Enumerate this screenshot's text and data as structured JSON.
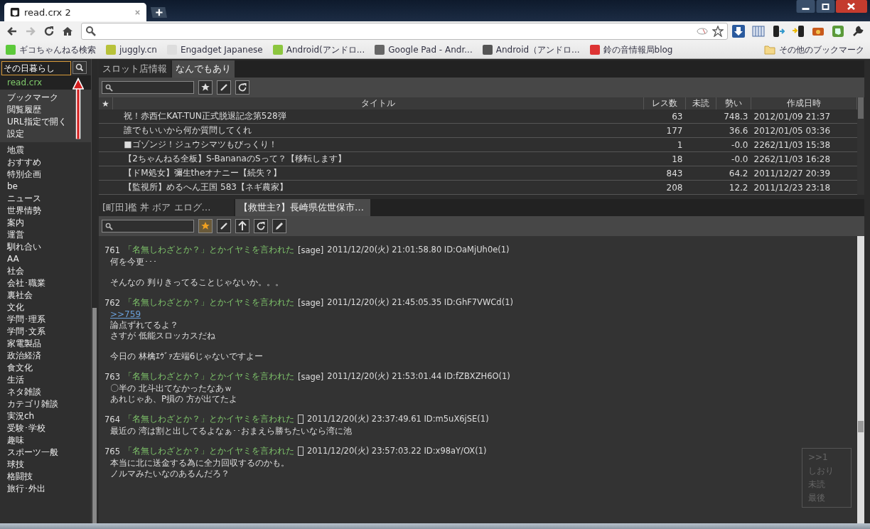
{
  "browser": {
    "tab_title": "read.crx 2",
    "bookmarks": [
      {
        "label": "ギコちゃんねる検索"
      },
      {
        "label": "juggly.cn"
      },
      {
        "label": "Engadget Japanese"
      },
      {
        "label": "Android(アンドロ..."
      },
      {
        "label": "Google Pad - Andr..."
      },
      {
        "label": "Android（アンドロ..."
      },
      {
        "label": "鈴の音情報局blog"
      }
    ],
    "other_bookmarks": "その他のブックマーク"
  },
  "sidebar": {
    "search_value": "その日暮らし",
    "title": "read.crx",
    "menu": [
      {
        "label": "ブックマーク"
      },
      {
        "label": "閲覧履歴"
      },
      {
        "label": "URL指定で開く"
      },
      {
        "label": "設定"
      }
    ],
    "boards": [
      "地震",
      "おすすめ",
      "特別企画",
      "be",
      "ニュース",
      "世界情勢",
      "案内",
      "運営",
      "馴れ合い",
      "AA",
      "社会",
      "会社･職業",
      "裏社会",
      "文化",
      "学問･理系",
      "学問･文系",
      "家電製品",
      "政治経済",
      "食文化",
      "生活",
      "ネタ雑談",
      "カテゴリ雑談",
      "実況ch",
      "受験･学校",
      "趣味",
      "スポーツ一般",
      "球技",
      "格闘技",
      "旅行･外出"
    ]
  },
  "board_pane": {
    "tabs": [
      {
        "label": "スロット店情報",
        "selected": false
      },
      {
        "label": "なんでもあり",
        "selected": true
      }
    ],
    "columns": [
      "★",
      "タイトル",
      "レス数",
      "未読",
      "勢い",
      "作成日時"
    ],
    "rows": [
      {
        "title": "祝！赤西仁KAT-TUN正式脱退記念第528弾",
        "res": "63",
        "speed": "748.3",
        "created": "2012/01/09 21:37"
      },
      {
        "title": "誰でもいいから何か質問してくれ",
        "res": "177",
        "speed": "36.6",
        "created": "2012/01/05 03:36"
      },
      {
        "title": "■ゴゾンジ！ジュウシマツもびっくり！",
        "res": "1",
        "speed": "-0.0",
        "created": "2262/11/03 15:38"
      },
      {
        "title": "【2ちゃんねる全板】S-BananaのSって？【移転します】",
        "res": "18",
        "speed": "-0.0",
        "created": "2262/11/03 16:28"
      },
      {
        "title": "【ドM処女】彌生theオナニー【続失？】",
        "res": "843",
        "speed": "64.2",
        "created": "2011/12/27 20:39"
      },
      {
        "title": "【監視所】めるへん王国 583【ネギ農家】",
        "res": "208",
        "speed": "12.2",
        "created": "2011/12/23 23:18"
      }
    ]
  },
  "thread_pane": {
    "tabs": [
      {
        "label": "[町田]檻  丼  ボア  エログ…",
        "selected": false
      },
      {
        "label": "【救世主?】長崎県佐世保市…",
        "selected": true
      }
    ],
    "bookmarked": true,
    "posts": [
      {
        "number": "761",
        "name": "「名無しわざとか？」とかイヤミを言われた",
        "mail": "[sage]",
        "date": "2011/12/20(火) 21:01:58.80 ID:OaMjUh0e(1)",
        "paragraphs": [
          [
            "何を今更･･･"
          ],
          [
            "そんなの 判りきってることじゃないか。。。"
          ]
        ]
      },
      {
        "number": "762",
        "name": "「名無しわざとか？」とかイヤミを言われた",
        "mail": "[sage]",
        "date": "2011/12/20(火) 21:45:05.35 ID:GhF7VWCd(1)",
        "anchor": ">>759",
        "paragraphs": [
          [
            "論点ずれてるよ？",
            "さすが 低能スロッカスだね"
          ],
          [
            "今日の 林檎ｴｳﾞｧ左端6じゃないですよー"
          ]
        ]
      },
      {
        "number": "763",
        "name": "「名無しわざとか？」とかイヤミを言われた",
        "mail": "[sage]",
        "date": "2011/12/20(火) 21:53:01.44 ID:fZBXZH6O(1)",
        "paragraphs": [
          [
            "〇半の 北斗出てなかったなあｗ",
            "あれじゃあ、P損の 方が出てたよ"
          ]
        ]
      },
      {
        "number": "764",
        "name": "「名無しわざとか？」とかイヤミを言われた",
        "mail_box": true,
        "date": "2011/12/20(火) 23:37:49.61 ID:m5uX6jSE(1)",
        "paragraphs": [
          [
            "最近の 湾は割と出してるよなぁ･･おまえら勝ちたいなら湾に池"
          ]
        ]
      },
      {
        "number": "765",
        "name": "「名無しわざとか？」とかイヤミを言われた",
        "mail_box": true,
        "date": "2011/12/20(火) 23:57:03.22 ID:x98aY/OX(1)",
        "paragraphs": [
          [
            "本当に北に送金する為に全力回収するのかも。",
            "ノルマみたいなのあるんだろ？"
          ]
        ]
      }
    ],
    "nav": [
      ">>1",
      "しおり",
      "未読",
      "最後"
    ]
  }
}
